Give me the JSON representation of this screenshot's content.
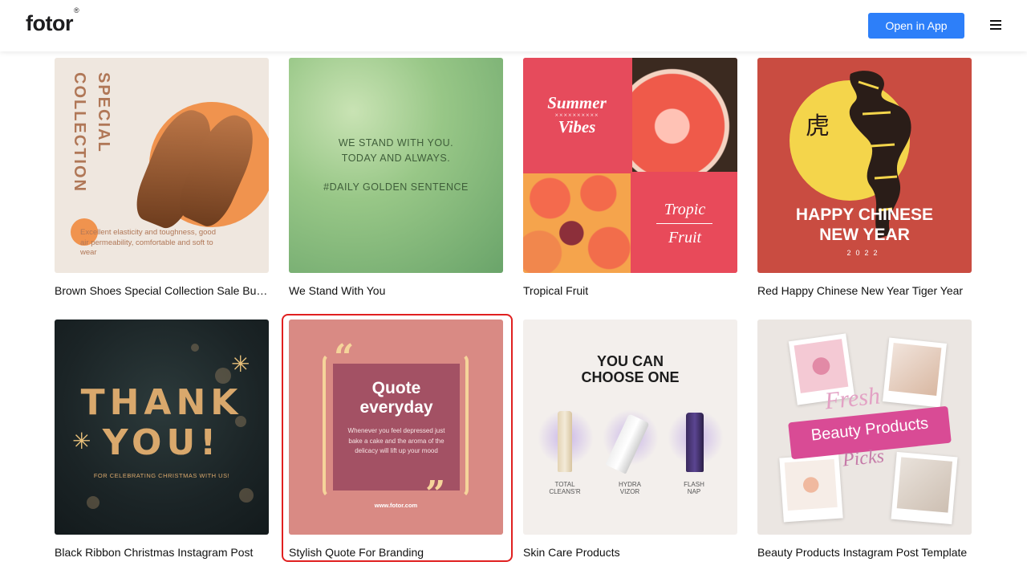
{
  "header": {
    "logo_text": "fotor",
    "logo_mark": "®",
    "open_app_label": "Open in App",
    "menu_icon": "hamburger-menu-icon"
  },
  "templates": [
    {
      "caption": "Brown Shoes Special Collection Sale Bu…",
      "thumb": {
        "title": "SPECIAL COLLECTION",
        "body": "Excellent elasticity and toughness, good air permeability, comfortable and soft to wear"
      }
    },
    {
      "caption": "We Stand With You",
      "thumb": {
        "line1": "WE STAND WITH YOU.",
        "line2": "TODAY AND ALWAYS.",
        "line3": "#DAILY GOLDEN SENTENCE"
      }
    },
    {
      "caption": "Tropical Fruit",
      "thumb": {
        "summer": "Summer",
        "xs": "××××××××××",
        "vibes": "Vibes",
        "tropic": "Tropic",
        "fruit": "Fruit"
      }
    },
    {
      "caption": "Red Happy Chinese New Year Tiger Year",
      "thumb": {
        "glyph": "虎",
        "line1": "HAPPY CHINESE",
        "line2": "NEW YEAR",
        "year": "2022"
      }
    },
    {
      "caption": "Black Ribbon Christmas Instagram Post",
      "thumb": {
        "line1": "THANK",
        "line2": "YOU!",
        "sub": "FOR CELEBRATING CHRISTMAS WITH US!"
      }
    },
    {
      "caption": "Stylish Quote For Branding",
      "selected": true,
      "thumb": {
        "title1": "Quote",
        "title2": "everyday",
        "body": "Whenever you feel depressed just bake a cake and the aroma of the delicacy will lift up your mood",
        "url": "www.fotor.com"
      }
    },
    {
      "caption": "Skin Care Products",
      "thumb": {
        "head1": "YOU CAN",
        "head2": "CHOOSE ONE",
        "p1a": "TOTAL",
        "p1b": "CLEANS'R",
        "p2a": "HYDRA",
        "p2b": "VIZOR",
        "p3a": "FLASH",
        "p3b": "NAP"
      }
    },
    {
      "caption": "Beauty Products Instagram Post Template",
      "thumb": {
        "fresh": "Fresh",
        "beauty": "Beauty Products",
        "picks": "Picks"
      }
    }
  ]
}
